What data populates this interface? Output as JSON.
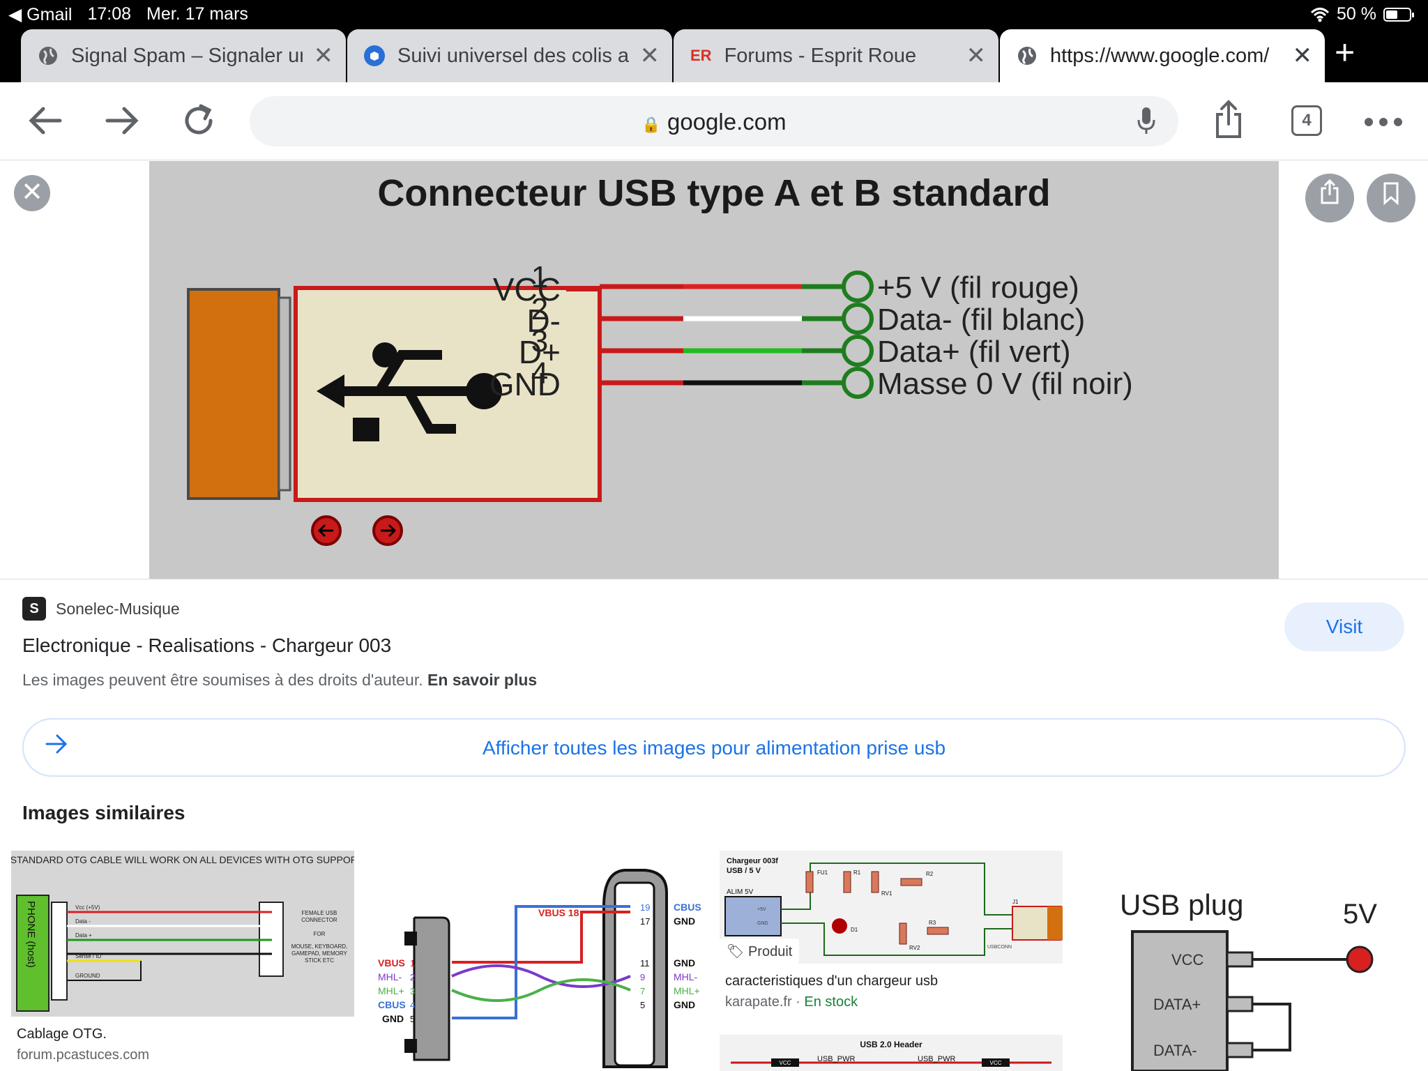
{
  "status_bar": {
    "back_app": "◀ Gmail",
    "time": "17:08",
    "date": "Mer. 17 mars",
    "battery": "50 %"
  },
  "tabs": [
    {
      "title": "Signal Spam – Signaler un",
      "favicon": "globe-icon"
    },
    {
      "title": "Suivi universel des colis a",
      "favicon": "parcel-icon"
    },
    {
      "title": "Forums - Esprit Roue",
      "favicon": "ER"
    },
    {
      "title": "https://www.google.com/",
      "favicon": "globe-icon",
      "active": true
    }
  ],
  "toolbar": {
    "url": "google.com",
    "tab_count": "4"
  },
  "viewer": {
    "image": {
      "title": "Connecteur USB type A et B standard",
      "pin_labels": [
        "VCC",
        "D-",
        "D+",
        "GND"
      ],
      "pin_numbers": [
        "1",
        "2",
        "3",
        "4"
      ],
      "wire_labels": [
        "+5 V (fil rouge)",
        "Data- (fil blanc)",
        "Data+ (fil vert)",
        "Masse 0 V (fil noir)"
      ]
    },
    "source_name": "Sonelec-Musique",
    "page_title": "Electronique - Realisations - Chargeur 003",
    "copyright_text": "Les images peuvent être soumises à des droits d'auteur.",
    "copyright_link": "En savoir plus",
    "visit_label": "Visit",
    "all_images_label": "Afficher toutes les images pour alimentation prise usb"
  },
  "similar": {
    "heading": "Images similaires",
    "items": [
      {
        "caption": "Cablage OTG.",
        "source": "forum.pcastuces.com",
        "header": "STANDARD OTG CABLE WILL WORK ON ALL DEVICES WITH OTG SUPPORT",
        "side_label": "PHONE (host)",
        "pins": [
          "Vcc (+5V)",
          "Data -",
          "Data +",
          "Sense / ID",
          "GROUND"
        ],
        "right_text": [
          "FEMALE USB",
          "CONNECTOR",
          "FOR",
          "MOUSE, KEYBOARD,",
          "GAMEPAD, MEMORY",
          "STICK ETC"
        ]
      },
      {
        "left_labels": [
          "VBUS",
          "MHL-",
          "MHL+",
          "CBUS",
          "GND"
        ],
        "left_pins": [
          "1",
          "2",
          "3",
          "4",
          "5"
        ],
        "right_labels": [
          "CBUS",
          "GND",
          "GND",
          "MHL-",
          "MHL+",
          "GND"
        ],
        "right_pins": [
          "19",
          "17",
          "11",
          "9",
          "7",
          "5"
        ],
        "vbus_label": "VBUS 18"
      },
      {
        "badge": "Produit",
        "caption": "caracteristiques d'un chargeur usb",
        "source": "karapate.fr",
        "stock": "En stock",
        "header": [
          "Chargeur 003f",
          "USB / 5 V"
        ],
        "labels": [
          "ALIM 5V",
          "FU1",
          "R1",
          "RV1",
          "R2",
          "J1",
          "D1",
          "RV2",
          "R3",
          "+5V",
          "GND",
          "USBCONN"
        ],
        "second_header": "USB 2.0 Header",
        "second_labels": [
          "VCC",
          "USB_PWR",
          "USB_PWR",
          "VCC"
        ]
      },
      {
        "title": "USB plug",
        "voltage": "5V",
        "pins": [
          "VCC",
          "DATA+",
          "DATA-"
        ]
      }
    ]
  },
  "colors": {
    "accent": "#1a73e8",
    "wire_red": "#e02020",
    "wire_green": "#1ebd1e",
    "wire_black": "#111111",
    "wire_white": "#ffffff",
    "connector_orange": "#d2700f",
    "pin_red": "#c81a1a",
    "pin_green": "#1f7d1f"
  }
}
